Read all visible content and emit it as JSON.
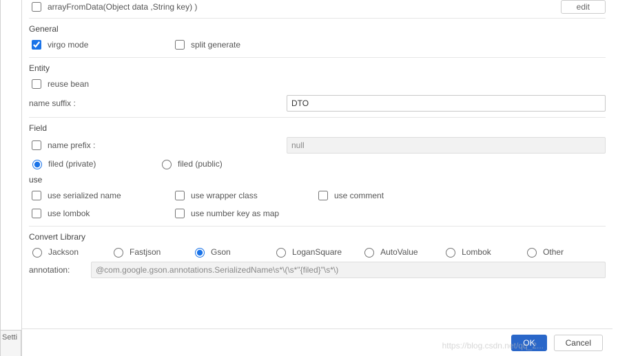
{
  "top": {
    "method_label": "arrayFromData(Object data ,String key) )",
    "edit_label": "edit"
  },
  "general": {
    "title": "General",
    "virgo_mode": "virgo mode",
    "split_generate": "split generate"
  },
  "entity": {
    "title": "Entity",
    "reuse_bean": "reuse bean",
    "name_suffix_label": "name suffix :",
    "name_suffix_value": "DTO"
  },
  "field": {
    "title": "Field",
    "name_prefix_label": "name prefix :",
    "name_prefix_value": "null",
    "private_label": "filed (private)",
    "public_label": "filed (public)"
  },
  "use": {
    "title": "use",
    "serialized": "use serialized name",
    "wrapper": "use wrapper class",
    "comment": "use comment",
    "lombok": "use lombok",
    "number_key": "use number key as map"
  },
  "library": {
    "title": "Convert Library",
    "jackson": "Jackson",
    "fastjson": "Fastjson",
    "gson": "Gson",
    "logansquare": "LoganSquare",
    "autovalue": "AutoValue",
    "lombok": "Lombok",
    "other": "Other",
    "annotation_label": "annotation:",
    "annotation_value": "@com.google.gson.annotations.SerializedName\\s*\\(\\s*\"{filed}\"\\s*\\)"
  },
  "footer": {
    "ok": "OK",
    "cancel": "Cancel",
    "watermark": "https://blog.csdn.net/qq_2..."
  },
  "edge_tab": "Setti"
}
